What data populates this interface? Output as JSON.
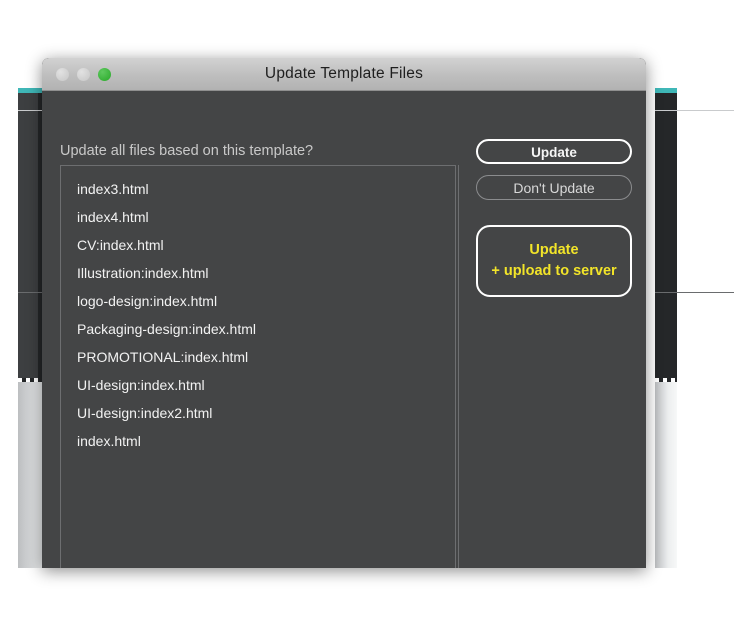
{
  "background": {
    "accent_color": "#3fb7b7",
    "panel_color": "#252729"
  },
  "dialog": {
    "title": "Update Template Files",
    "titlebar": {
      "close_label": "close",
      "minimize_label": "minimize",
      "maximize_label": "maximize",
      "close_color": "#c6c6c6",
      "minimize_color": "#c6c6c6",
      "maximize_color": "#28a828"
    },
    "prompt": "Update all files based on this template?",
    "file_list": [
      "index3.html",
      "index4.html",
      "CV:index.html",
      "Illustration:index.html",
      "logo-design:index.html",
      "Packaging-design:index.html",
      "PROMOTIONAL:index.html",
      "UI-design:index.html",
      "UI-design:index2.html",
      "index.html"
    ],
    "buttons": {
      "update": "Update",
      "dont_update": "Don't Update",
      "upload_line1": "Update",
      "upload_line2": "+ upload to server",
      "upload_text_color": "#f2e429"
    }
  }
}
